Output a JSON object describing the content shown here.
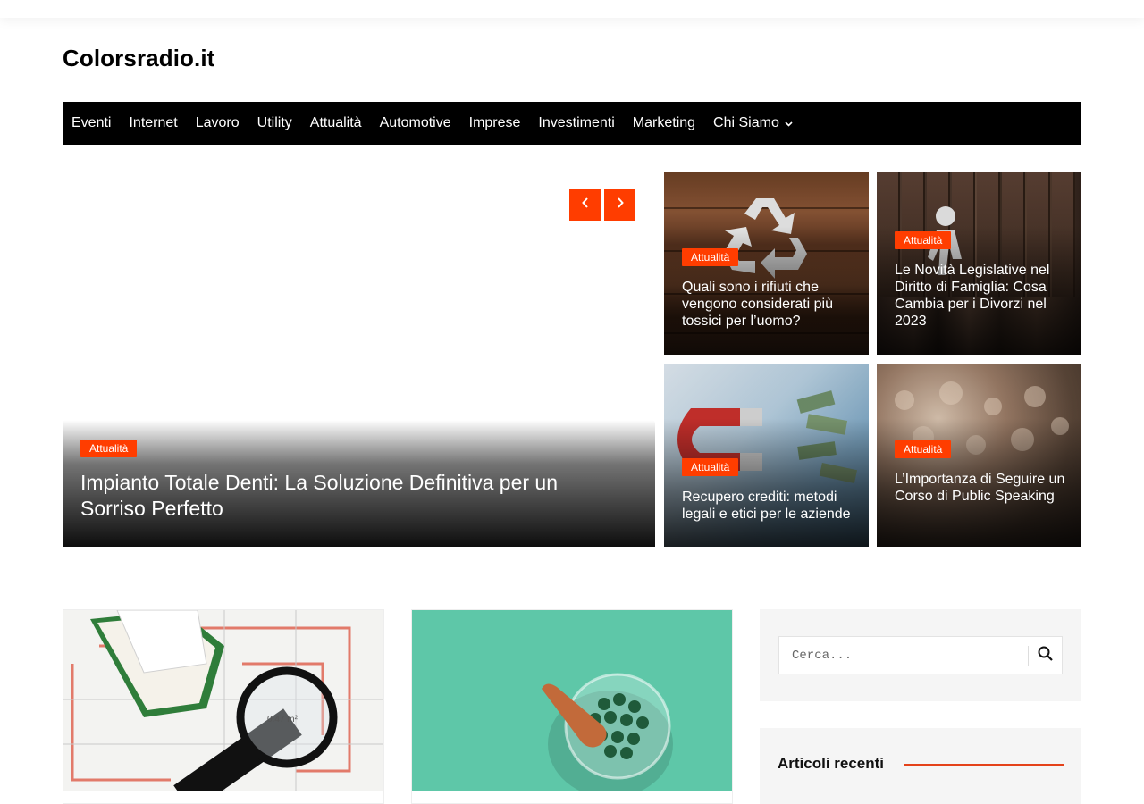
{
  "site": {
    "title": "Colorsradio.it"
  },
  "nav": {
    "items": [
      "Eventi",
      "Internet",
      "Lavoro",
      "Utility",
      "Attualità",
      "Automotive",
      "Imprese",
      "Investimenti",
      "Marketing",
      "Chi Siamo"
    ]
  },
  "hero": {
    "category": "Attualità",
    "title": "Impianto Totale Denti: La Soluzione Definitiva per un Sorriso Perfetto",
    "prev_icon": "chevron-left-icon",
    "next_icon": "chevron-right-icon"
  },
  "tiles": [
    {
      "category": "Attualità",
      "title": "Quali sono i rifiuti che vengono considerati più tossici per l’uomo?"
    },
    {
      "category": "Attualità",
      "title": "Le Novità Legislative nel Diritto di Famiglia: Cosa Cambia per i Divorzi nel 2023"
    },
    {
      "category": "Attualità",
      "title": "Recupero crediti: metodi legali e etici per le aziende"
    },
    {
      "category": "Attualità",
      "title": "L’Importanza di Seguire un Corso di Public Speaking"
    }
  ],
  "sidebar": {
    "search_placeholder": "Cerca...",
    "search_icon": "search-icon",
    "recent_title": "Articoli recenti"
  },
  "colors": {
    "accent": "#ff3d00",
    "nav_bg": "#000000",
    "sidebar_bg": "#f5f5f5"
  }
}
